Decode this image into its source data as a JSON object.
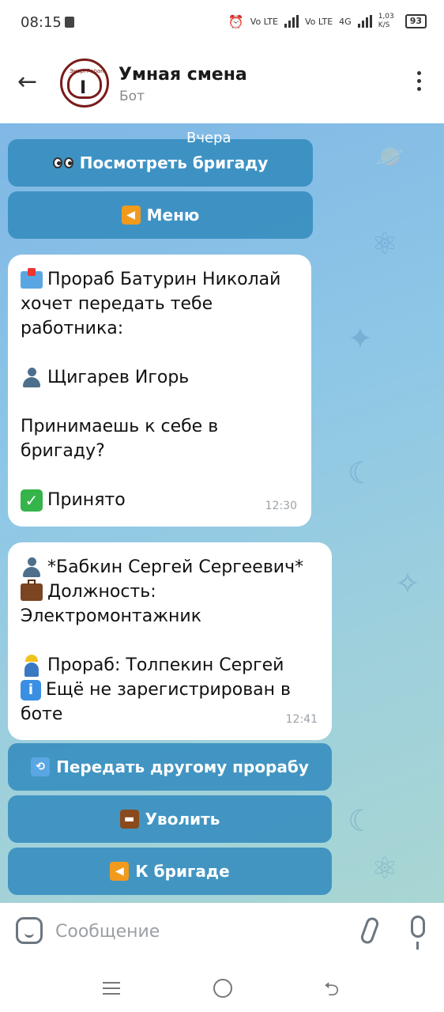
{
  "status_bar": {
    "time": "08:15",
    "net1": "Vo LTE",
    "net2": "Vo LTE",
    "net3": "4G",
    "speed": "1,03 K/S",
    "battery": "93"
  },
  "header": {
    "back_icon": "arrow-left-icon",
    "title": "Умная смена",
    "subtitle": "Бот",
    "avatar_text": "ЭнергГарант"
  },
  "chat": {
    "date_label": "Вчера",
    "top_keyboard": [
      {
        "label": "Посмотреть бригаду",
        "icon": "eyes-icon"
      },
      {
        "label": "Меню",
        "icon": "left-arrow-box-icon"
      }
    ],
    "messages": [
      {
        "lines": [
          {
            "icon": "inbox-tray-icon",
            "text": "Прораб Батурин Николай"
          },
          {
            "icon": "",
            "text": "хочет передать тебе"
          },
          {
            "icon": "",
            "text": "работника:"
          },
          {
            "icon": "",
            "text": ""
          },
          {
            "icon": "person-icon",
            "text": "Щигарев Игорь"
          },
          {
            "icon": "",
            "text": ""
          },
          {
            "icon": "",
            "text": "Принимаешь к себе в"
          },
          {
            "icon": "",
            "text": "бригаду?"
          },
          {
            "icon": "",
            "text": ""
          },
          {
            "icon": "check-icon",
            "text": "Принято"
          }
        ],
        "time": "12:30"
      },
      {
        "lines": [
          {
            "icon": "person-icon",
            "text": "*Бабкин Сергей Сергеевич*"
          },
          {
            "icon": "briefcase-icon",
            "text": "Должность:"
          },
          {
            "icon": "",
            "text": "Электромонтажник"
          },
          {
            "icon": "",
            "text": ""
          },
          {
            "icon": "construction-worker-icon",
            "text": "Прораб: Толпекин Сергей"
          },
          {
            "icon": "info-icon",
            "text": "Ещё не зарегистрирован в"
          },
          {
            "icon": "",
            "text": "боте"
          }
        ],
        "time": "12:41"
      }
    ],
    "bottom_keyboard": [
      {
        "label": "Передать другому прорабу",
        "icon": "arrows-counterclockwise-icon"
      },
      {
        "label": "Уволить",
        "icon": "briefcase-icon"
      },
      {
        "label": "К бригаде",
        "icon": "left-arrow-box-icon"
      }
    ]
  },
  "input": {
    "placeholder": "Сообщение"
  }
}
